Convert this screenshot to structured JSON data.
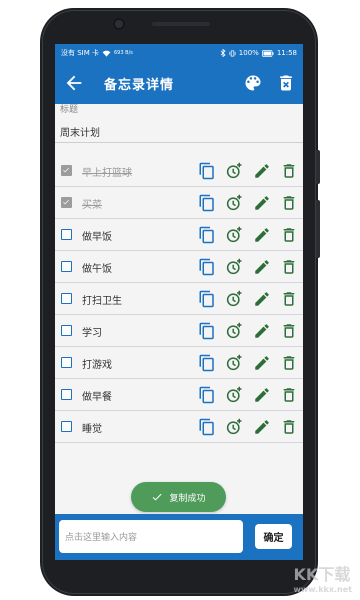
{
  "statusbar": {
    "left": "没有 SIM 卡",
    "speed": "693 B/s",
    "battery": "100%",
    "time": "11:58"
  },
  "appbar": {
    "title": "备忘录详情"
  },
  "memo": {
    "title_label": "标题",
    "title_value": "周末计划"
  },
  "items": [
    {
      "text": "早上打篮球",
      "done": true
    },
    {
      "text": "买菜",
      "done": true
    },
    {
      "text": "做早饭",
      "done": false
    },
    {
      "text": "做午饭",
      "done": false
    },
    {
      "text": "打扫卫生",
      "done": false
    },
    {
      "text": "学习",
      "done": false
    },
    {
      "text": "打游戏",
      "done": false
    },
    {
      "text": "做早餐",
      "done": false
    },
    {
      "text": "睡觉",
      "done": false
    }
  ],
  "toast": {
    "text": "复制成功"
  },
  "bottom": {
    "input_placeholder": "点击这里输入内容",
    "confirm_label": "确定"
  },
  "colors": {
    "primary": "#1b72c0",
    "action_green": "#2e6e3a",
    "toast_green": "#4f9b5a"
  },
  "watermark": {
    "text": "KK下载",
    "sub": "www.kkx.net"
  }
}
